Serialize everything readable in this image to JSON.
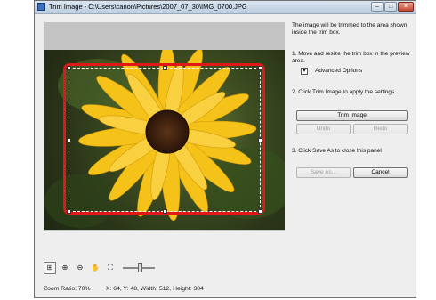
{
  "window": {
    "title": "Trim Image - C:\\Users\\canon\\Pictures\\2007_07_30\\IMG_0700.JPG",
    "buttons": {
      "minimize": "–",
      "maximize": "□",
      "close": "✕"
    }
  },
  "panel": {
    "intro": "The image will be trimmed to the area shown inside the trim box.",
    "step1": "1.  Move and resize the trim box in the preview area.",
    "advanced_options": "Advanced Options",
    "step2": "2. Click Trim Image to apply the settings.",
    "trim_image": "Trim Image",
    "undo": "Undo",
    "redo": "Redo",
    "step3": "3. Click Save As to close this panel",
    "save_as": "Save As...",
    "cancel": "Cancel"
  },
  "status": {
    "zoom_ratio": "Zoom Ratio: 70%",
    "trim_info": "X: 64, Y: 48, Width: 512, Height: 384"
  },
  "toolbar": {
    "icons": [
      "fit-icon",
      "zoom-in-icon",
      "zoom-out-icon",
      "hand-icon",
      "trim-box-icon"
    ],
    "zoom_slider_level": 0.55
  },
  "colors": {
    "trim_frame": "#e01818",
    "petal": "#f5c21a",
    "center": "#3a1f0e"
  }
}
